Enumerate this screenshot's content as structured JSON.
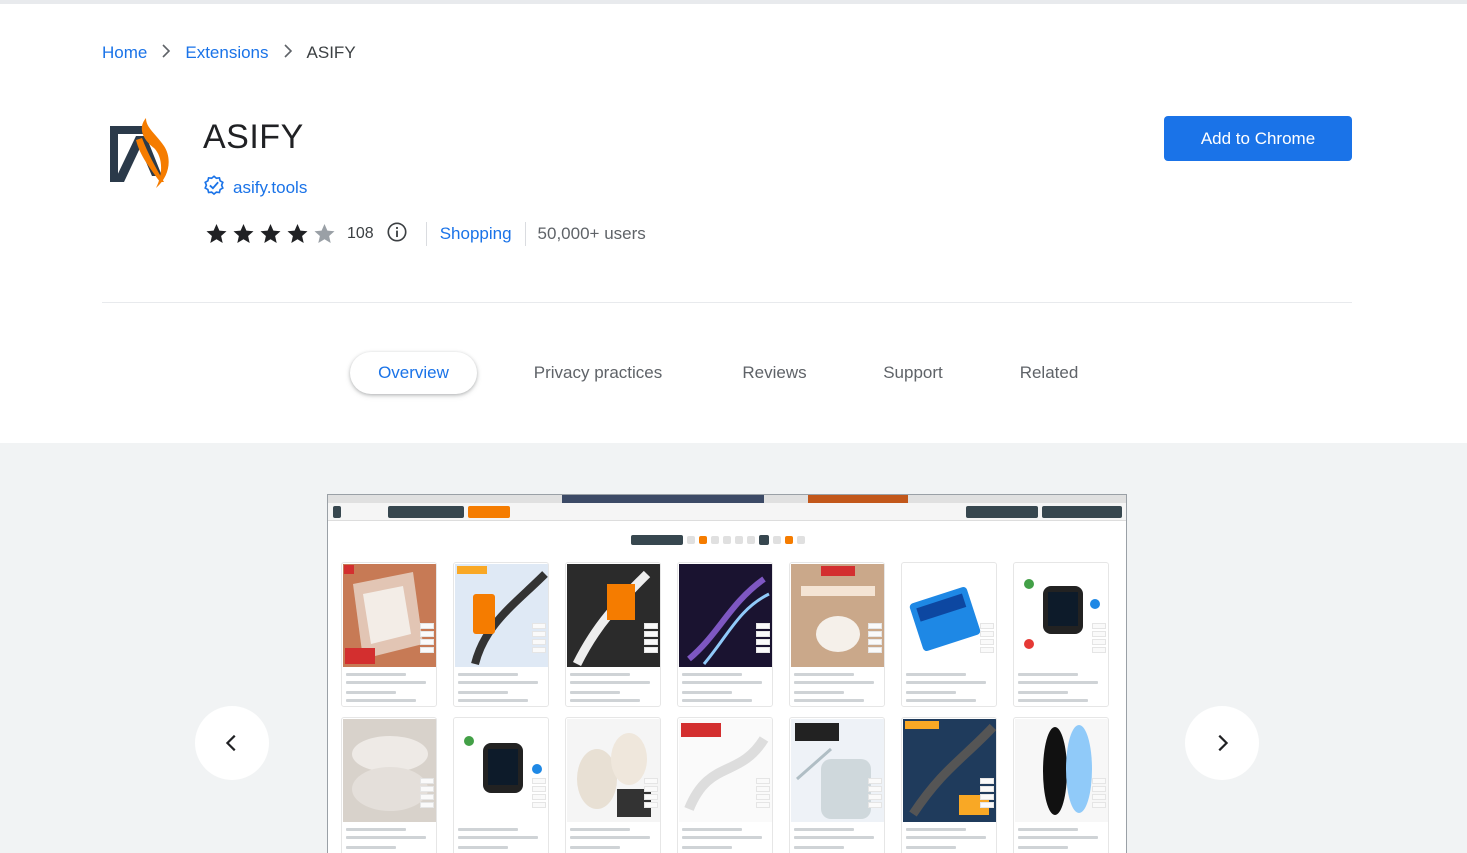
{
  "breadcrumb": {
    "home": "Home",
    "extensions": "Extensions",
    "current": "ASIFY"
  },
  "extension": {
    "name": "ASIFY",
    "site": "asify.tools",
    "rating": 4,
    "rating_count": "108",
    "category": "Shopping",
    "users": "50,000+ users",
    "add_button": "Add to Chrome"
  },
  "tabs": [
    {
      "label": "Overview",
      "active": true
    },
    {
      "label": "Privacy practices",
      "active": false
    },
    {
      "label": "Reviews",
      "active": false
    },
    {
      "label": "Support",
      "active": false
    },
    {
      "label": "Related",
      "active": false
    }
  ],
  "icons": {
    "verified": "verified-badge-icon",
    "info": "info-icon",
    "prev": "chevron-left-icon",
    "next": "chevron-right-icon"
  },
  "colors": {
    "accent": "#1a73e8",
    "logo_orange": "#f57c00",
    "logo_dark": "#2b3a4a"
  }
}
